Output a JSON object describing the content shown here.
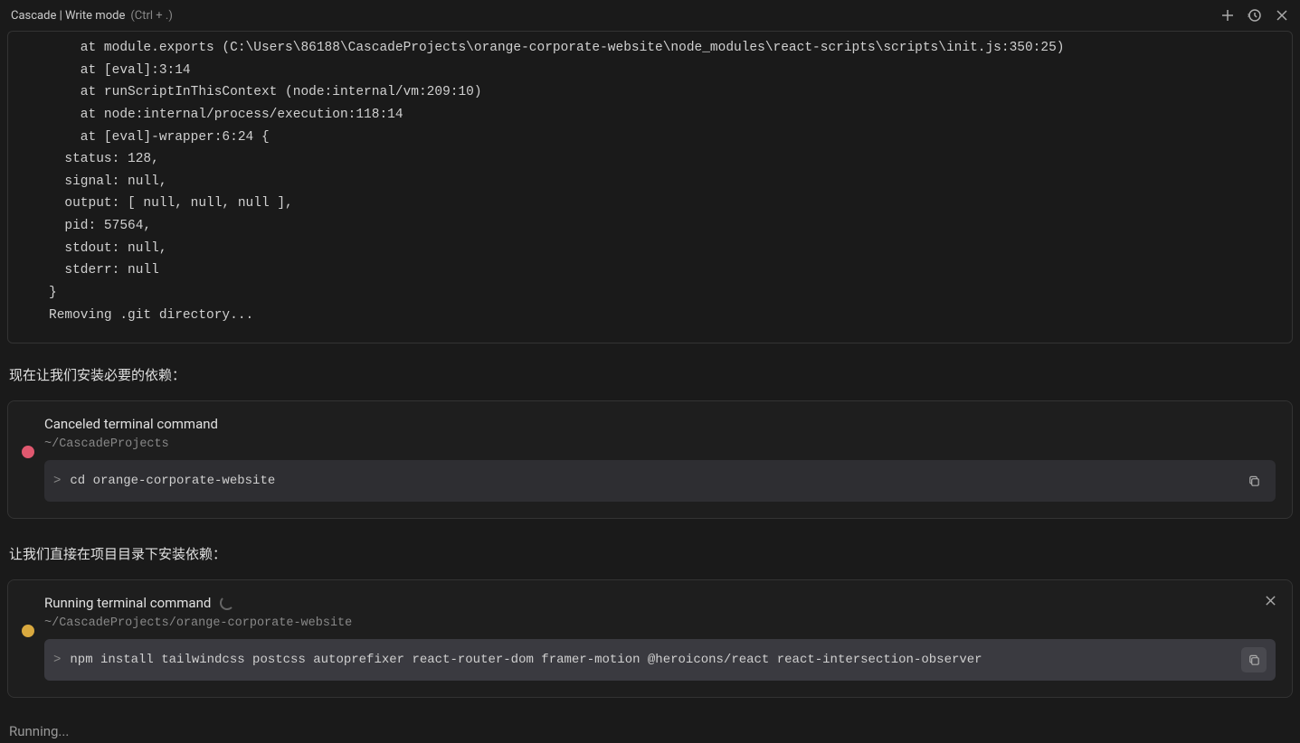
{
  "header": {
    "title": "Cascade | Write mode",
    "shortcut": "(Ctrl + .)"
  },
  "terminal_output": "    at module.exports (C:\\Users\\86188\\CascadeProjects\\orange-corporate-website\\node_modules\\react-scripts\\scripts\\init.js:350:25)\n    at [eval]:3:14\n    at runScriptInThisContext (node:internal/vm:209:10)\n    at node:internal/process/execution:118:14\n    at [eval]-wrapper:6:24 {\n  status: 128,\n  signal: null,\n  output: [ null, null, null ],\n  pid: 57564,\n  stdout: null,\n  stderr: null\n}\nRemoving .git directory...",
  "narration1": "现在让我们安装必要的依赖：",
  "block1": {
    "status_title": "Canceled terminal command",
    "path": "~/CascadeProjects",
    "prompt": ">",
    "command": "cd orange-corporate-website"
  },
  "narration2": "让我们直接在项目目录下安装依赖：",
  "block2": {
    "status_title": "Running terminal command",
    "path": "~/CascadeProjects/orange-corporate-website",
    "prompt": ">",
    "command": "npm install tailwindcss postcss autoprefixer react-router-dom framer-motion @heroicons/react react-intersection-observer"
  },
  "footer_status": "Running..."
}
